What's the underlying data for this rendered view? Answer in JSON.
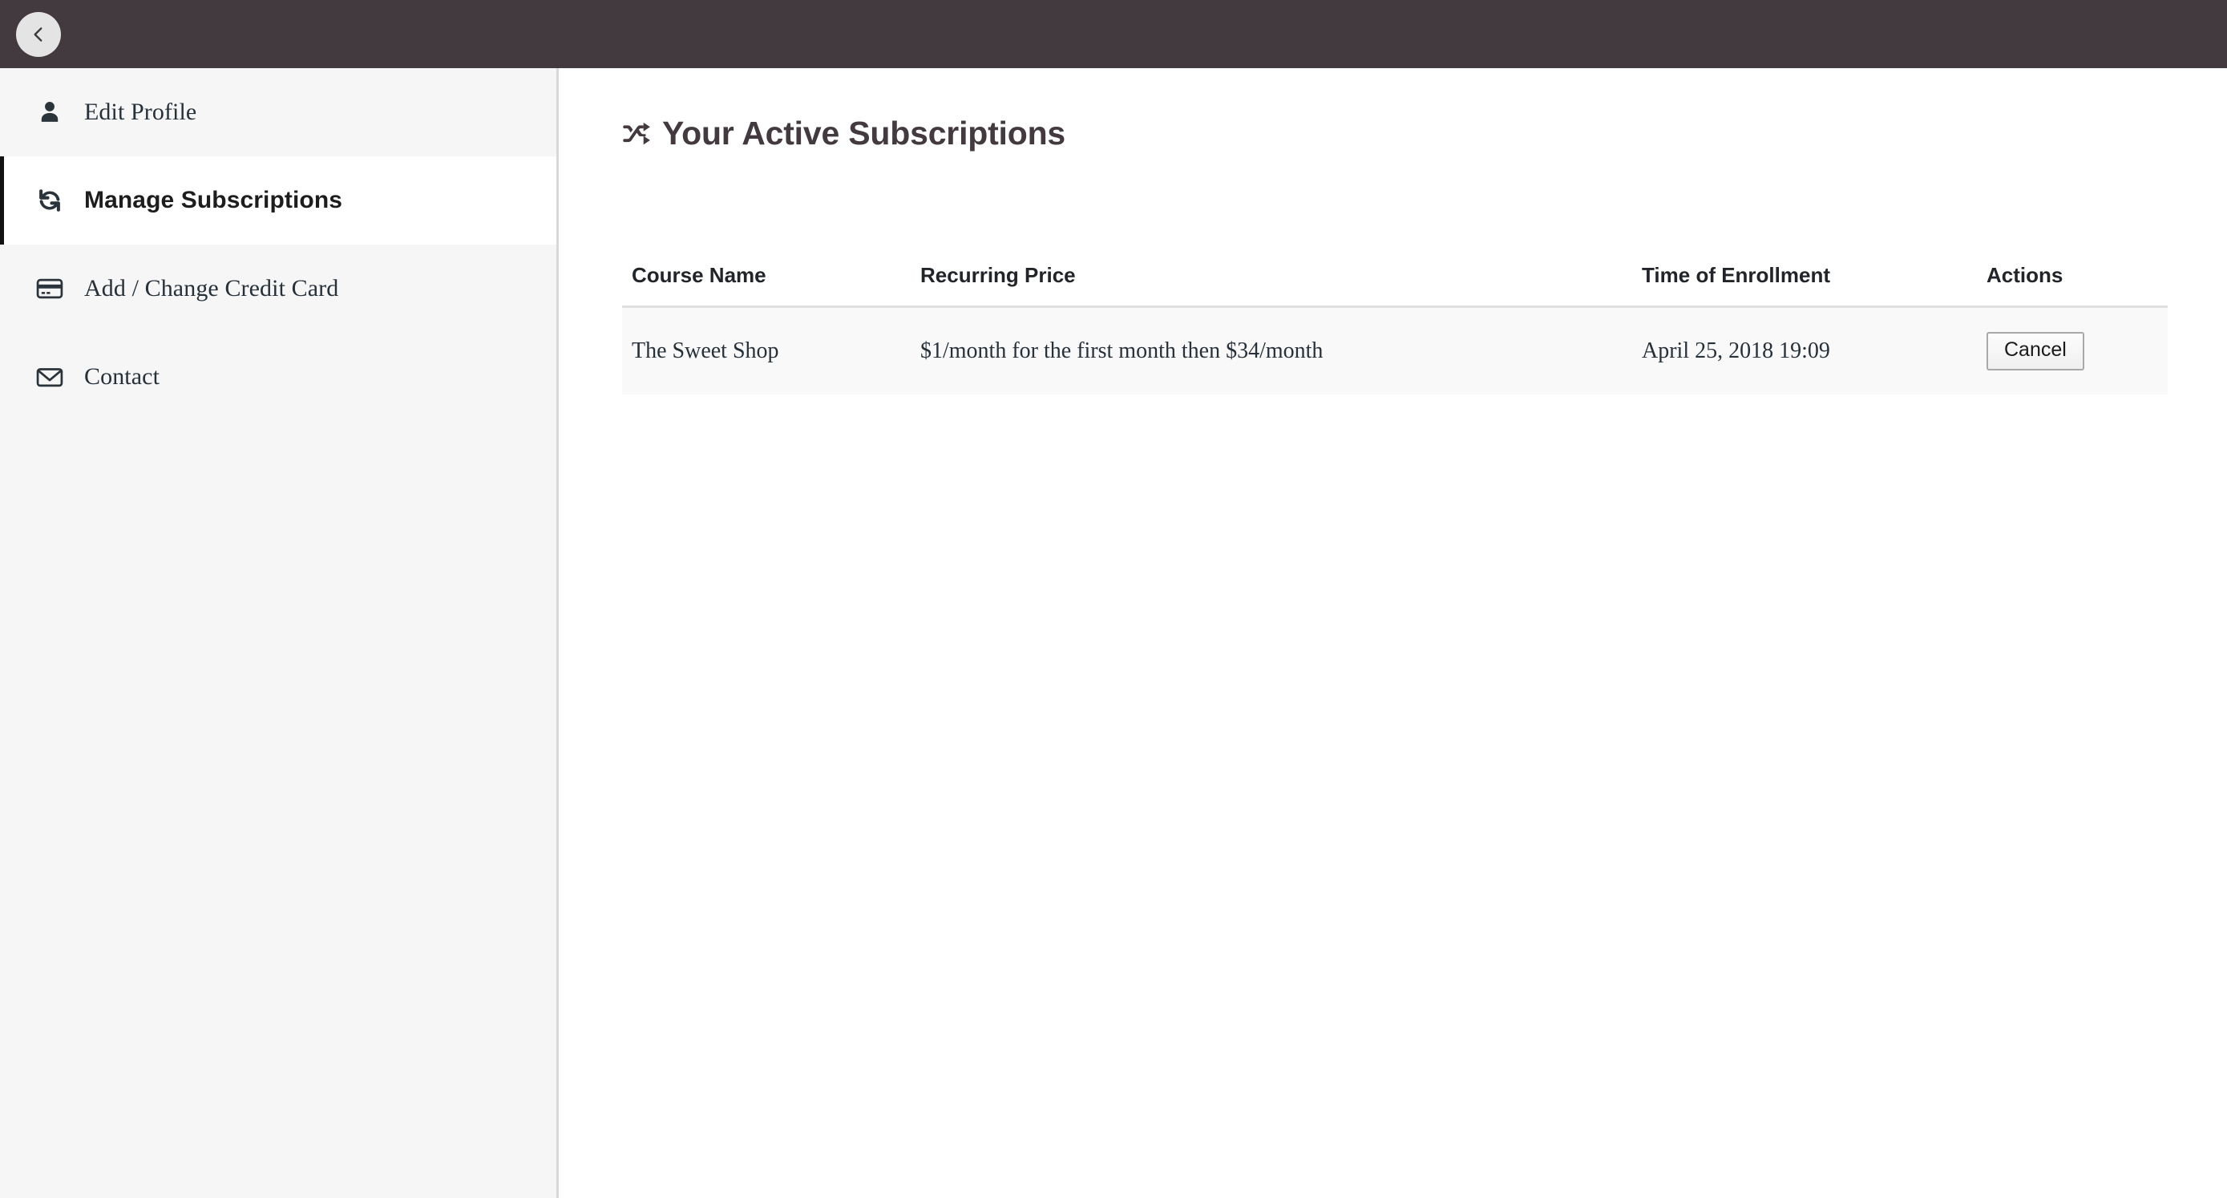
{
  "header": {
    "back_button_icon": "chevron-left-icon",
    "background_color": "#433A40"
  },
  "sidebar": {
    "items": [
      {
        "label": "Edit Profile",
        "icon": "user-icon",
        "active": false
      },
      {
        "label": "Manage Subscriptions",
        "icon": "sync-icon",
        "active": true
      },
      {
        "label": "Add / Change Credit Card",
        "icon": "credit-card-icon",
        "active": false
      },
      {
        "label": "Contact",
        "icon": "envelope-icon",
        "active": false
      }
    ]
  },
  "main": {
    "heading": {
      "icon": "shuffle-icon",
      "text": "Your Active Subscriptions"
    },
    "table": {
      "columns": [
        "Course Name",
        "Recurring Price",
        "Time of Enrollment",
        "Actions"
      ],
      "rows": [
        {
          "course_name": "The Sweet Shop",
          "recurring_price": "$1/month for the first month then $34/month",
          "time_of_enrollment": "April 25, 2018 19:09",
          "action_label": "Cancel"
        }
      ]
    }
  }
}
